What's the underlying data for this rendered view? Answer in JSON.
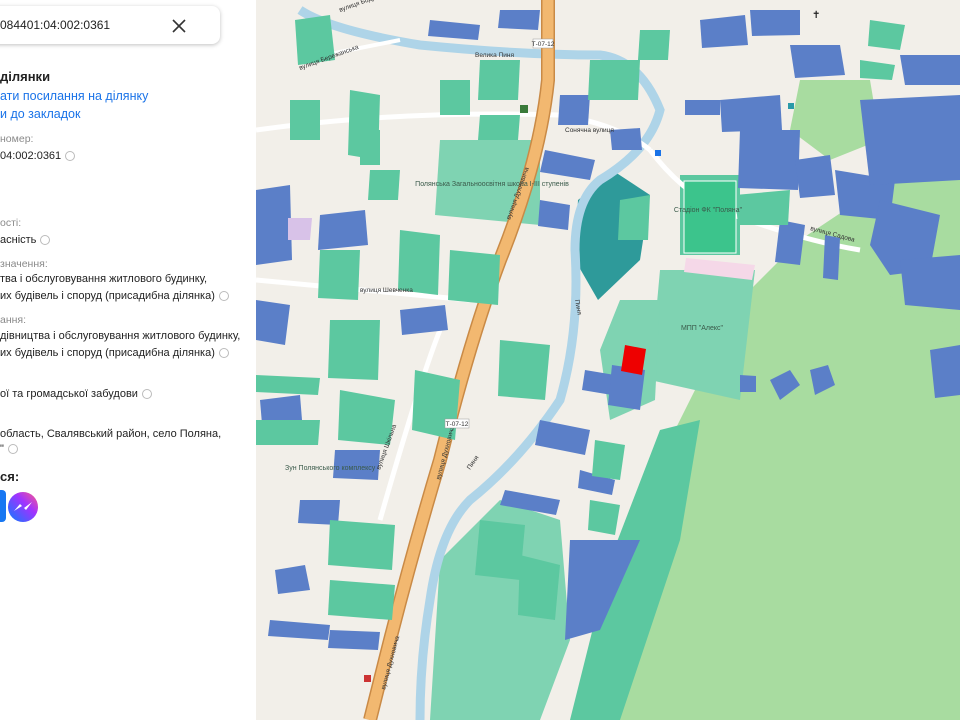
{
  "search": {
    "query": "084401:04:002:0361"
  },
  "info": {
    "heading": "ділянки",
    "actions": [
      "ати посилання на ділянку",
      "и до закладок"
    ],
    "cadastral_label": "номер:",
    "cadastral_value": "04:002:0361",
    "ownership_label": "ості:",
    "ownership_value": "асність",
    "purpose_label": "значення:",
    "purpose_line1": "тва і обслуговування житлового будинку,",
    "purpose_line2": "их будівель і споруд (присадибна ділянка)",
    "use_label": "ання:",
    "use_line1": "дівництва і обслуговування житлового будинку,",
    "use_line2": "их будівель і споруд (присадибна ділянка)",
    "category_value": "ої та громадської забудови",
    "address_line1": "область, Свалявський район, село Поляна,",
    "address_line2": "\"",
    "share_label": "ся:"
  },
  "map": {
    "streets": [
      "вулиця Духновича",
      "вулиця Шкільна",
      "вулиця Шевченка",
      "вулиця Бережанська",
      "Сонячна вулиця",
      "вулиця Бодрадка",
      "Велика Пиня",
      "Пиня",
      "Пиня",
      "вулиця Садова"
    ],
    "road_codes": [
      "Т-07-12",
      "Т-07-12"
    ],
    "places": [
      "Полянська Загальноосвітня школа I-III ступенів",
      "Стадіон ФК \"Поляна\"",
      "МПП \"Алекс\"",
      "Зун Полянського комплексу"
    ],
    "colors": {
      "parcel_blue": "#5b7fc8",
      "parcel_green": "#5cc8a0",
      "parcel_teal": "#2e9a9a",
      "forest": "#a8dca0",
      "road": "#f2b870",
      "river": "#aed4e8",
      "selected": "#ee0000"
    }
  }
}
